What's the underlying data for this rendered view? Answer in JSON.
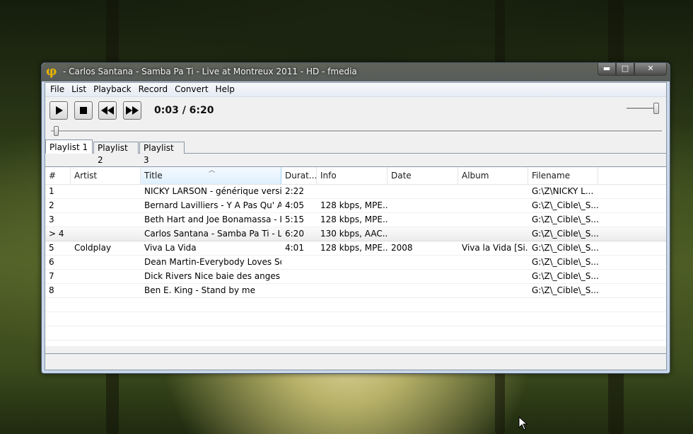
{
  "window": {
    "title": " - Carlos Santana - Samba Pa Ti  - Live at Montreux 2011 - HD - fmedia",
    "caption_buttons": {
      "minimize": "▬",
      "maximize": "□",
      "close": "✕"
    },
    "icon": "phi-logo-icon"
  },
  "menu": {
    "items": [
      {
        "label": "File"
      },
      {
        "label": "List"
      },
      {
        "label": "Playback"
      },
      {
        "label": "Record"
      },
      {
        "label": "Convert"
      },
      {
        "label": "Help"
      }
    ]
  },
  "toolbar": {
    "play_icon": "play-icon",
    "stop_icon": "stop-icon",
    "prev_icon": "rewind-icon",
    "next_icon": "fast-forward-icon",
    "time": "0:03 / 6:20"
  },
  "tabs": [
    {
      "label": "Playlist 1",
      "active": true
    },
    {
      "label": "Playlist 2",
      "active": false
    },
    {
      "label": "Playlist 3",
      "active": false
    }
  ],
  "playlist": {
    "columns": [
      "#",
      "Artist",
      "Title",
      "Durat...",
      "Info",
      "Date",
      "Album",
      "Filename"
    ],
    "sorted_column": "Title",
    "rows": [
      {
        "num": "1",
        "artist": "",
        "title": "NICKY LARSON - générique versi...",
        "duration": "2:22",
        "info": "",
        "date": "",
        "album": "",
        "filename": "G:\\Z\\NICKY L..."
      },
      {
        "num": "2",
        "artist": "",
        "title": "Bernard Lavilliers - Y A Pas Qu' A ...",
        "duration": "4:05",
        "info": "128 kbps, MPE...",
        "date": "",
        "album": "",
        "filename": "G:\\Z\\_Cible\\_S..."
      },
      {
        "num": "3",
        "artist": "",
        "title": "Beth Hart and Joe Bonamassa - I'l...",
        "duration": "5:15",
        "info": "128 kbps, MPE...",
        "date": "",
        "album": "",
        "filename": "G:\\Z\\_Cible\\_S..."
      },
      {
        "num": "> 4",
        "artist": "",
        "title": "Carlos Santana - Samba Pa Ti  - Li...",
        "duration": "6:20",
        "info": "130 kbps, AAC...",
        "date": "",
        "album": "",
        "filename": "G:\\Z\\_Cible\\_S..."
      },
      {
        "num": "5",
        "artist": "Coldplay",
        "title": "Viva La Vida",
        "duration": "4:01",
        "info": "128 kbps, MPE...",
        "date": "2008",
        "album": "Viva la Vida [Si...",
        "filename": "G:\\Z\\_Cible\\_S..."
      },
      {
        "num": "6",
        "artist": "",
        "title": "Dean Martin-Everybody Loves So...",
        "duration": "",
        "info": "",
        "date": "",
        "album": "",
        "filename": "G:\\Z\\_Cible\\_S..."
      },
      {
        "num": "7",
        "artist": "",
        "title": "Dick Rivers Nice baie des anges",
        "duration": "",
        "info": "",
        "date": "",
        "album": "",
        "filename": "G:\\Z\\_Cible\\_S..."
      },
      {
        "num": "8",
        "artist": "",
        "title": "Ben E. King - Stand by me",
        "duration": "",
        "info": "",
        "date": "",
        "album": "",
        "filename": "G:\\Z\\_Cible\\_S..."
      }
    ],
    "playing_row": 3
  },
  "colors": {
    "window_frame": "#c9d7e8",
    "logo": "#e8b400",
    "sorted_header": "#dff0fd"
  }
}
